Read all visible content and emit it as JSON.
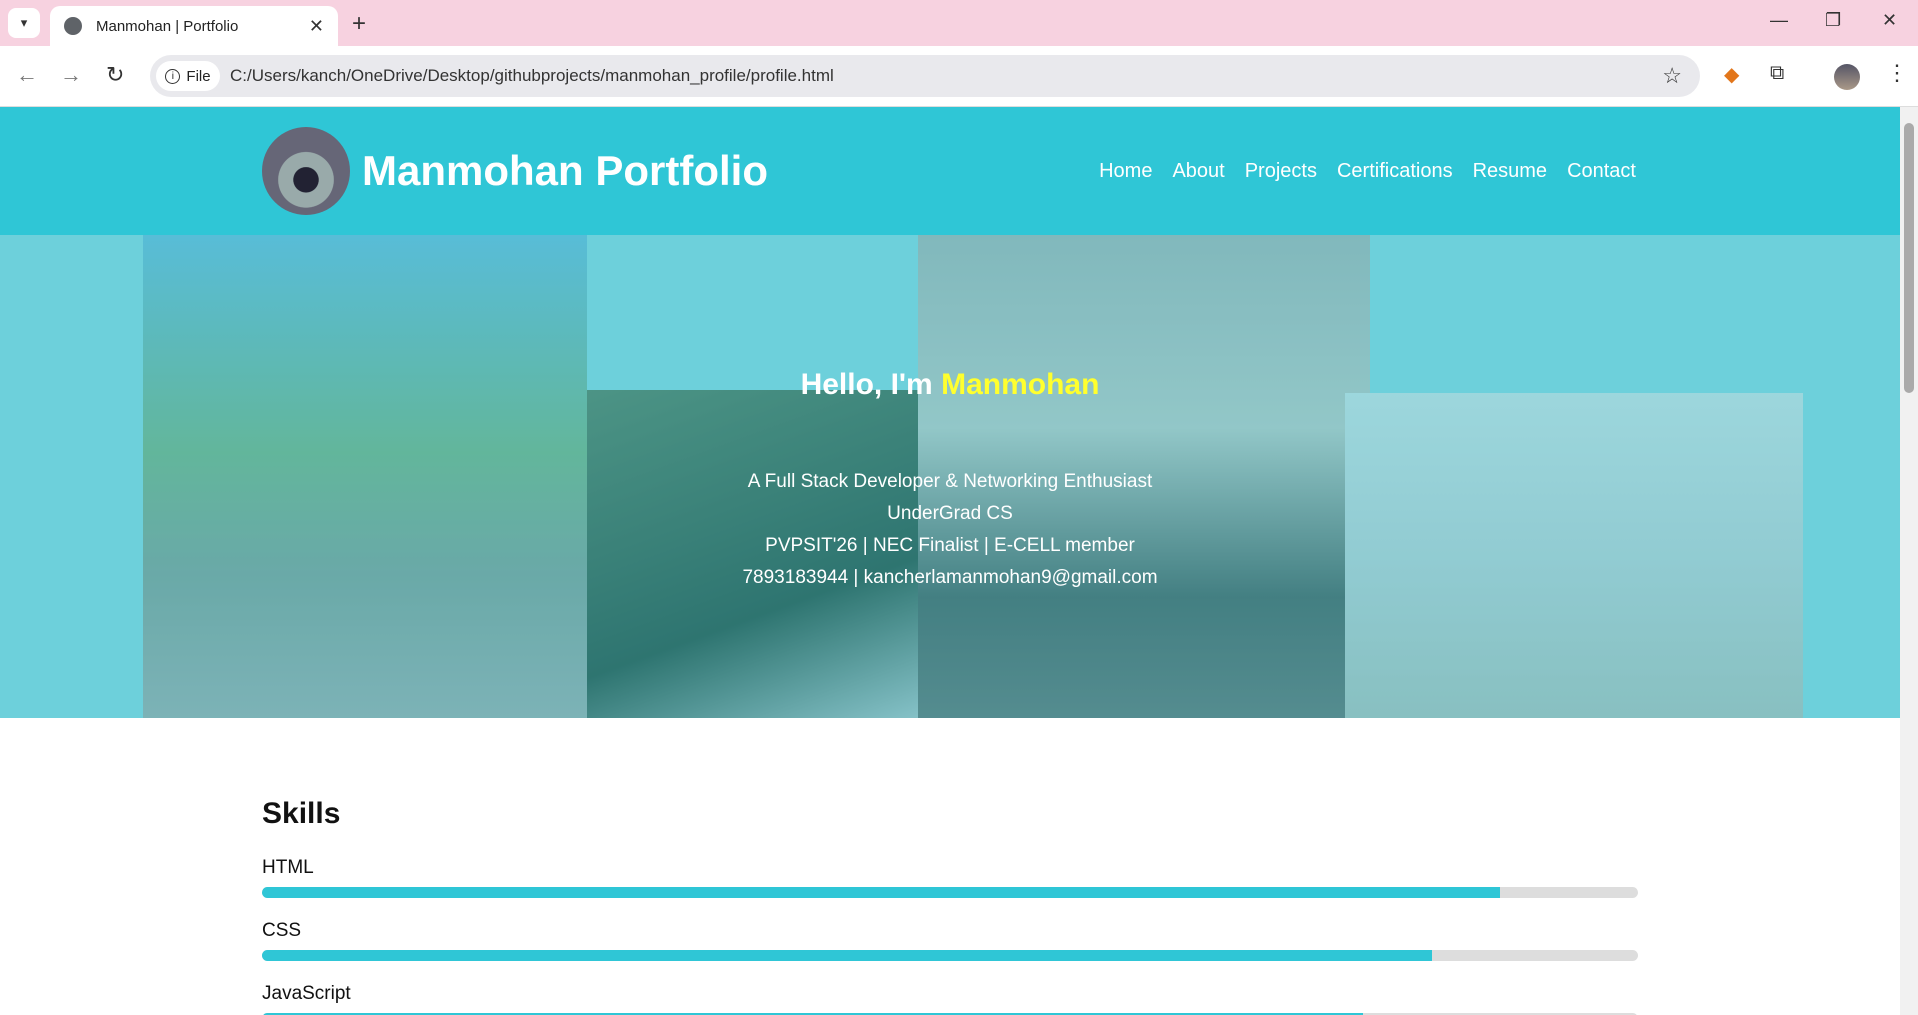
{
  "browser": {
    "tab_title": "Manmohan | Portfolio",
    "address": "C:/Users/kanch/OneDrive/Desktop/githubprojects/manmohan_profile/profile.html",
    "chip_label": "File"
  },
  "site": {
    "brand": "Manmohan Portfolio",
    "nav": [
      "Home",
      "About",
      "Projects",
      "Certifications",
      "Resume",
      "Contact"
    ],
    "accent_color": "#2fc6d6",
    "highlight_color": "#ffff2e"
  },
  "hero": {
    "greeting": "Hello, I'm",
    "name": "Manmohan",
    "lines": [
      "A Full Stack Developer & Networking Enthusiast",
      "UnderGrad CS",
      "PVPSIT'26 | NEC Finalist | E-CELL member",
      "7893183944 | kancherlamanmohan9@gmail.com"
    ]
  },
  "skills": {
    "title": "Skills",
    "items": [
      {
        "name": "HTML",
        "level": 0.9
      },
      {
        "name": "CSS",
        "level": 0.85
      },
      {
        "name": "JavaScript",
        "level": 0.8
      }
    ]
  }
}
